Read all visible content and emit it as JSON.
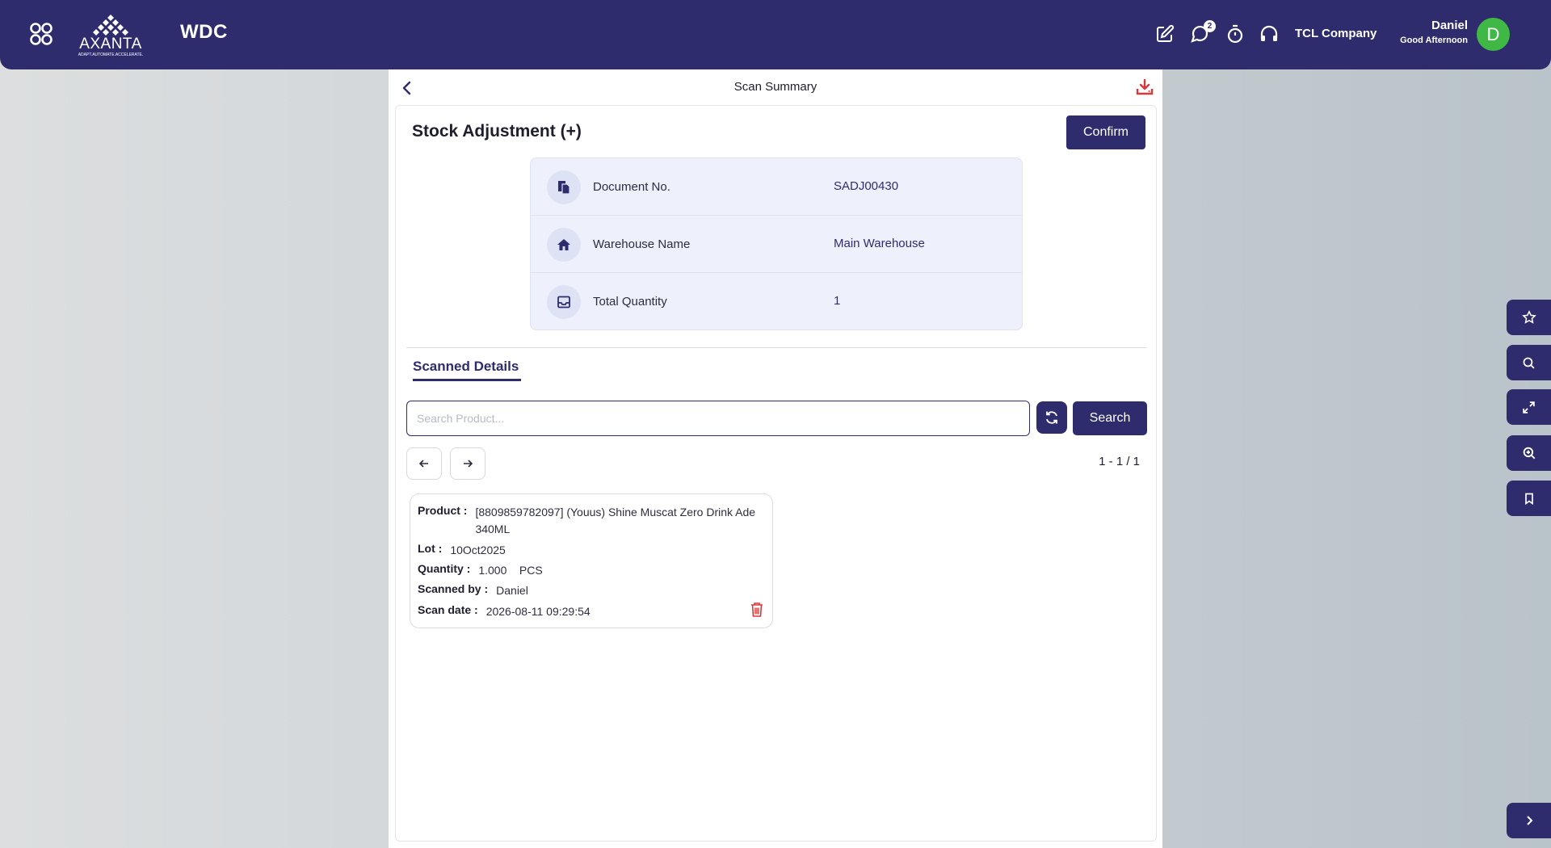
{
  "header": {
    "logo_text": "AXANTA",
    "logo_tagline": "ADAPT.AUTOMATE.ACCELERATE.",
    "app_name": "WDC",
    "notifications_count": "2",
    "company": "TCL Company",
    "user_name": "Daniel",
    "greeting": "Good Afternoon",
    "avatar_initial": "D"
  },
  "panel": {
    "title": "Scan Summary",
    "document_title": "Stock Adjustment (+)",
    "confirm_label": "Confirm"
  },
  "info": {
    "rows": [
      {
        "icon": "document-icon",
        "label": "Document No.",
        "value": "SADJ00430"
      },
      {
        "icon": "home-icon",
        "label": "Warehouse Name",
        "value": "Main Warehouse"
      },
      {
        "icon": "inbox-icon",
        "label": "Total Quantity",
        "value": "1"
      }
    ]
  },
  "tabs": {
    "scanned_details": "Scanned Details"
  },
  "search": {
    "placeholder": "Search Product...",
    "button_label": "Search"
  },
  "pager": {
    "info": "1 - 1 / 1"
  },
  "items": [
    {
      "product_key": "Product :",
      "product": "[8809859782097] (Youus) Shine Muscat Zero Drink Ade 340ML",
      "lot_key": "Lot :",
      "lot": "10Oct2025",
      "quantity_key": "Quantity :",
      "quantity": "1.000    PCS",
      "scanned_by_key": "Scanned by :",
      "scanned_by": "Daniel",
      "scan_date_key": "Scan date :",
      "scan_date": "2026-08-11 09:29:54"
    }
  ],
  "colors": {
    "primary": "#2e2c6d",
    "avatar": "#3fb845",
    "danger": "#d9383a",
    "card_bg": "#eef1fb"
  }
}
